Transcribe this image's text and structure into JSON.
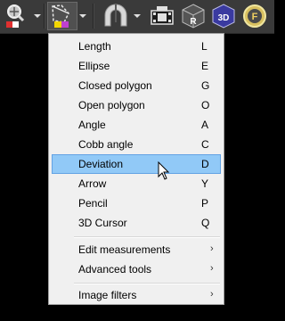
{
  "toolbar": {
    "tools": [
      {
        "name": "zoom-magnifier",
        "icon": "magnifier-icon"
      },
      {
        "name": "measure-roi",
        "icon": "roi-measure-icon",
        "pressed": true
      },
      {
        "name": "horseshoe",
        "icon": "horseshoe-icon"
      },
      {
        "name": "movie",
        "icon": "film-camera-icon"
      },
      {
        "name": "mpr",
        "icon": "mpr-cube-icon",
        "letter": "R"
      },
      {
        "name": "3d",
        "icon": "3d-cube-icon",
        "letter": "3D"
      },
      {
        "name": "fusion",
        "icon": "fusion-icon",
        "letter": "F"
      }
    ]
  },
  "menu": {
    "items": [
      {
        "label": "Length",
        "shortcut": "L"
      },
      {
        "label": "Ellipse",
        "shortcut": "E"
      },
      {
        "label": "Closed polygon",
        "shortcut": "G"
      },
      {
        "label": "Open polygon",
        "shortcut": "O"
      },
      {
        "label": "Angle",
        "shortcut": "A"
      },
      {
        "label": "Cobb angle",
        "shortcut": "C"
      },
      {
        "label": "Deviation",
        "shortcut": "D",
        "highlighted": true
      },
      {
        "label": "Arrow",
        "shortcut": "Y"
      },
      {
        "label": "Pencil",
        "shortcut": "P"
      },
      {
        "label": "3D Cursor",
        "shortcut": "Q"
      }
    ],
    "submenus": [
      {
        "label": "Edit measurements",
        "arrow": "›"
      },
      {
        "label": "Advanced tools",
        "arrow": "›"
      },
      {
        "label": "Image filters",
        "arrow": "›"
      }
    ]
  },
  "colors": {
    "toolbar_bg": "#3a3a3a",
    "menu_bg": "#f0f0f0",
    "highlight_bg": "#91c9f7",
    "highlight_border": "#62a2e4"
  }
}
